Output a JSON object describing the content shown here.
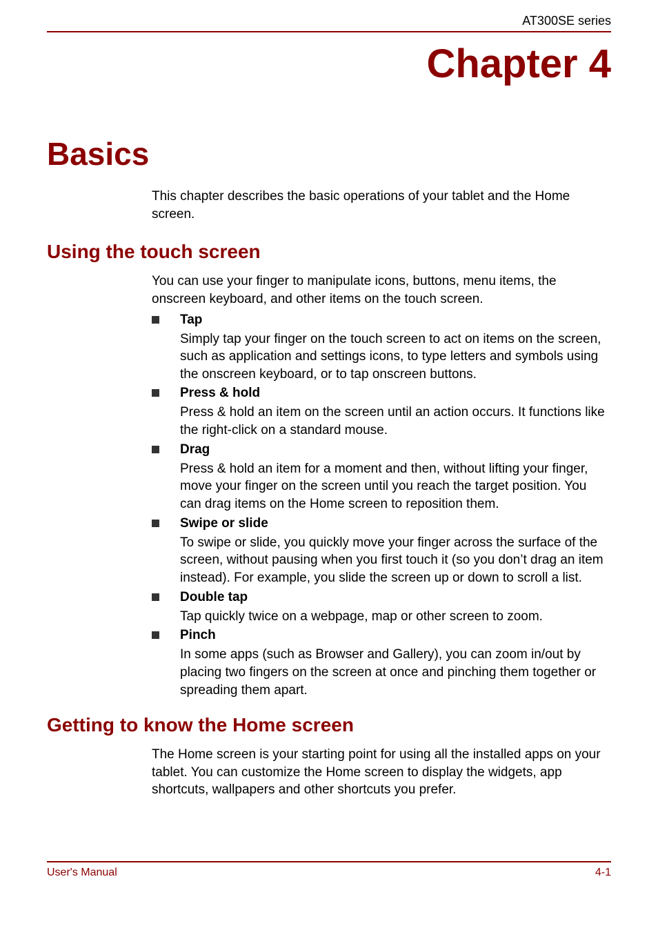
{
  "header": {
    "product": "AT300SE series"
  },
  "chapter": {
    "label": "Chapter 4",
    "title": "Basics",
    "intro": "This chapter describes the basic operations of your tablet and the Home screen."
  },
  "section_touch": {
    "heading": "Using the touch screen",
    "intro": "You can use your finger to manipulate icons, buttons, menu items, the onscreen keyboard, and other items on the touch screen.",
    "gestures": [
      {
        "title": "Tap",
        "desc": "Simply tap your finger on the touch screen to act on items on the screen, such as application and settings icons, to type letters and symbols using the onscreen keyboard, or to tap onscreen buttons."
      },
      {
        "title": "Press & hold",
        "desc": "Press & hold an item on the screen until an action occurs. It functions like the right-click on a standard mouse."
      },
      {
        "title": "Drag",
        "desc": "Press & hold an item for a moment and then, without lifting your finger, move your finger on the screen until you reach the target position. You can drag items on the Home screen to reposition them."
      },
      {
        "title": "Swipe or slide",
        "desc": "To swipe or slide, you quickly move your finger across the surface of the screen, without pausing when you first touch it (so you don’t drag an item instead). For example, you slide the screen up or down to scroll a list."
      },
      {
        "title": "Double tap",
        "desc": "Tap quickly twice on a webpage, map or other screen to zoom."
      },
      {
        "title": "Pinch",
        "desc": "In some apps (such as Browser and Gallery), you can zoom in/out by placing two fingers on the screen at once and pinching them together or spreading them apart."
      }
    ]
  },
  "section_home": {
    "heading": "Getting to know the Home screen",
    "intro": "The Home screen is your starting point for using all the installed apps on your tablet. You can customize the Home screen to display the widgets, app shortcuts, wallpapers and other shortcuts you prefer."
  },
  "footer": {
    "left": "User's Manual",
    "right": "4-1"
  }
}
